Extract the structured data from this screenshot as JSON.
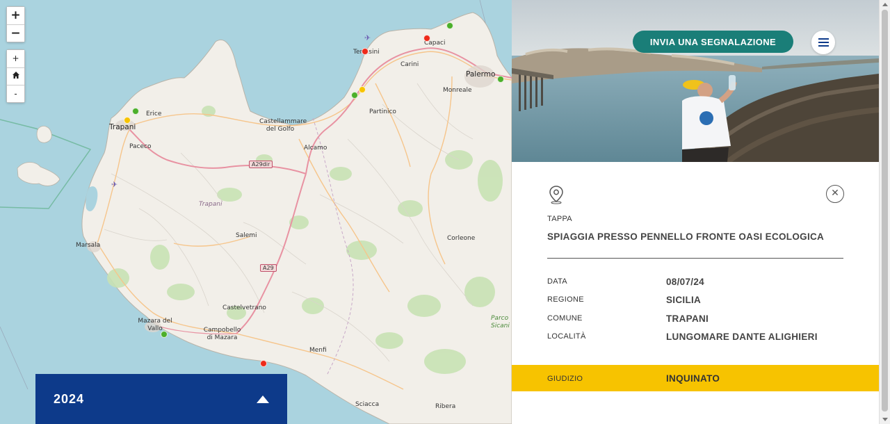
{
  "map": {
    "controls": {
      "zoom_in": "+",
      "zoom_out": "−",
      "small_in": "+",
      "home_icon": "home-icon",
      "small_out": "-"
    },
    "places": [
      {
        "name": "Erice",
        "kind": "town"
      },
      {
        "name": "Trapani",
        "kind": "city"
      },
      {
        "name": "Paceco",
        "kind": "town"
      },
      {
        "name": "Castellammare del Golfo",
        "kind": "town"
      },
      {
        "name": "Alcamo",
        "kind": "town"
      },
      {
        "name": "Partinico",
        "kind": "town"
      },
      {
        "name": "Terrasini",
        "kind": "town"
      },
      {
        "name": "Capaci",
        "kind": "town"
      },
      {
        "name": "Carini",
        "kind": "town"
      },
      {
        "name": "Palermo",
        "kind": "city"
      },
      {
        "name": "Monreale",
        "kind": "town"
      },
      {
        "name": "Trapani",
        "kind": "province"
      },
      {
        "name": "Salemi",
        "kind": "town"
      },
      {
        "name": "Marsala",
        "kind": "town"
      },
      {
        "name": "Corleone",
        "kind": "town"
      },
      {
        "name": "Castelvetrano",
        "kind": "town"
      },
      {
        "name": "Mazara del Vallo",
        "kind": "town"
      },
      {
        "name": "Campobello di Mazara",
        "kind": "town"
      },
      {
        "name": "Menfi",
        "kind": "town"
      },
      {
        "name": "Sciacca",
        "kind": "town"
      },
      {
        "name": "Ribera",
        "kind": "town"
      },
      {
        "name": "Parco Sicani",
        "kind": "park"
      }
    ],
    "roads": [
      "A29dir",
      "A29"
    ],
    "pins": [
      {
        "status": "green"
      },
      {
        "status": "yellow"
      },
      {
        "status": "red"
      },
      {
        "status": "yellow"
      },
      {
        "status": "green"
      },
      {
        "status": "red"
      },
      {
        "status": "green"
      },
      {
        "status": "green"
      },
      {
        "status": "green"
      },
      {
        "status": "red"
      }
    ],
    "colors": {
      "green": "#4caf2a",
      "yellow": "#f7c300",
      "red": "#ee2a1a"
    }
  },
  "year_selector": {
    "year": "2024"
  },
  "header": {
    "report_button": "INVIA UNA SEGNALAZIONE",
    "menu_icon": "hamburger-icon"
  },
  "detail": {
    "tappa_label": "TAPPA",
    "tappa_value": "SPIAGGIA PRESSO PENNELLO FRONTE OASI ECOLOGICA",
    "rows": [
      {
        "label": "DATA",
        "value": "08/07/24"
      },
      {
        "label": "REGIONE",
        "value": "SICILIA"
      },
      {
        "label": "COMUNE",
        "value": "TRAPANI"
      },
      {
        "label": "LOCALITÀ",
        "value": "LUNGOMARE DANTE ALIGHIERI"
      }
    ],
    "giudizio": {
      "label": "GIUDIZIO",
      "value": "INQUINATO"
    }
  }
}
